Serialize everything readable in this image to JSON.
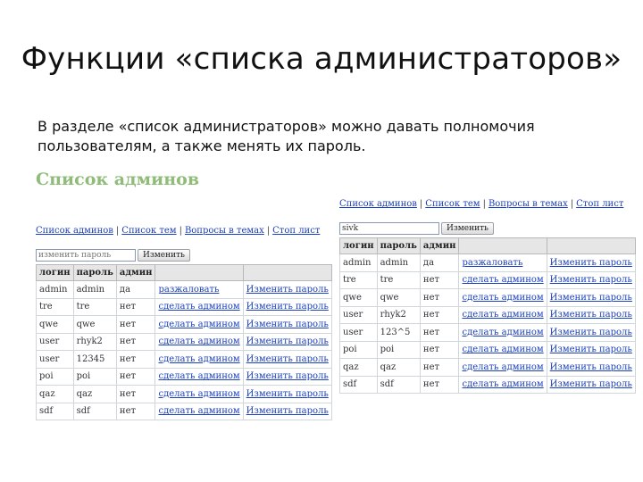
{
  "slide": {
    "title": "Функции «списка администраторов»",
    "text": "В разделе «список администраторов» можно давать полномочия пользователям, а также менять их пароль.",
    "panel_heading": "Список админов"
  },
  "colors": {
    "heading_green": "#8fbc78",
    "link_blue": "#1a3fbf",
    "header_gray": "#e6e6e6"
  },
  "left": {
    "nav": [
      "Список админов",
      "Список тем",
      "Вопросы в темах",
      "Стоп лист"
    ],
    "input_value": "",
    "placeholder": "изменить пароль",
    "button": "Изменить",
    "headers": [
      "логин",
      "пароль",
      "админ",
      "",
      ""
    ],
    "rows": [
      {
        "login": "admin",
        "password": "admin",
        "admin": "да",
        "action": "разжаловать",
        "change": "Изменить пароль"
      },
      {
        "login": "tre",
        "password": "tre",
        "admin": "нет",
        "action": "сделать админом",
        "change": "Изменить пароль"
      },
      {
        "login": "qwe",
        "password": "qwe",
        "admin": "нет",
        "action": "сделать админом",
        "change": "Изменить пароль"
      },
      {
        "login": "user",
        "password": "rhyk2",
        "admin": "нет",
        "action": "сделать админом",
        "change": "Изменить пароль"
      },
      {
        "login": "user",
        "password": "12345",
        "admin": "нет",
        "action": "сделать админом",
        "change": "Изменить пароль"
      },
      {
        "login": "poi",
        "password": "poi",
        "admin": "нет",
        "action": "сделать админом",
        "change": "Изменить пароль"
      },
      {
        "login": "qaz",
        "password": "qaz",
        "admin": "нет",
        "action": "сделать админом",
        "change": "Изменить пароль"
      },
      {
        "login": "sdf",
        "password": "sdf",
        "admin": "нет",
        "action": "сделать админом",
        "change": "Изменить пароль"
      }
    ]
  },
  "right": {
    "nav": [
      "Список админов",
      "Список тем",
      "Вопросы в темах",
      "Стоп лист"
    ],
    "input_value": "sivk",
    "placeholder": "",
    "button": "Изменить",
    "headers": [
      "логин",
      "пароль",
      "админ",
      "",
      ""
    ],
    "rows": [
      {
        "login": "admin",
        "password": "admin",
        "admin": "да",
        "action": "разжаловать",
        "change": "Изменить пароль"
      },
      {
        "login": "tre",
        "password": "tre",
        "admin": "нет",
        "action": "сделать админом",
        "change": "Изменить пароль"
      },
      {
        "login": "qwe",
        "password": "qwe",
        "admin": "нет",
        "action": "сделать админом",
        "change": "Изменить пароль"
      },
      {
        "login": "user",
        "password": "rhyk2",
        "admin": "нет",
        "action": "сделать админом",
        "change": "Изменить пароль"
      },
      {
        "login": "user",
        "password": "123^5",
        "admin": "нет",
        "action": "сделать админом",
        "change": "Изменить пароль"
      },
      {
        "login": "poi",
        "password": "poi",
        "admin": "нет",
        "action": "сделать админом",
        "change": "Изменить пароль"
      },
      {
        "login": "qaz",
        "password": "qaz",
        "admin": "нет",
        "action": "сделать админом",
        "change": "Изменить пароль"
      },
      {
        "login": "sdf",
        "password": "sdf",
        "admin": "нет",
        "action": "сделать админом",
        "change": "Изменить пароль"
      }
    ]
  }
}
